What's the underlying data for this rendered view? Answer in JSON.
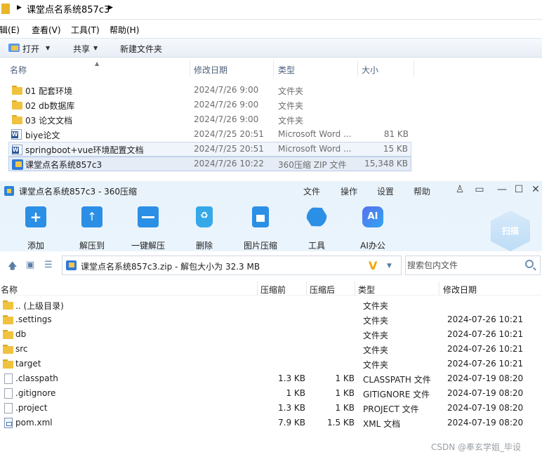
{
  "explorer": {
    "breadcrumb": "课堂点名系统857c3",
    "menu": [
      "辑(E)",
      "查看(V)",
      "工具(T)",
      "帮助(H)"
    ],
    "toolbar": {
      "open": "打开",
      "share": "共享",
      "new_folder": "新建文件夹"
    },
    "columns": [
      "名称",
      "修改日期",
      "类型",
      "大小"
    ],
    "files": [
      {
        "icon": "folder-icon",
        "name": "01 配套环境",
        "date": "2024/7/26 9:00",
        "type": "文件夹",
        "size": ""
      },
      {
        "icon": "folder-icon",
        "name": "02 db数据库",
        "date": "2024/7/26 9:00",
        "type": "文件夹",
        "size": ""
      },
      {
        "icon": "folder-icon",
        "name": "03 论文文档",
        "date": "2024/7/26 9:00",
        "type": "文件夹",
        "size": ""
      },
      {
        "icon": "word-doc-icon",
        "name": "biye论文",
        "date": "2024/7/25 20:51",
        "type": "Microsoft Word ...",
        "size": "81 KB"
      },
      {
        "icon": "word-doc-icon",
        "name": "springboot+vue环境配置文档",
        "date": "2024/7/25 20:51",
        "type": "Microsoft Word ...",
        "size": "15 KB"
      },
      {
        "icon": "zip-icon",
        "name": "课堂点名系统857c3",
        "date": "2024/7/26 10:22",
        "type": "360压缩 ZIP 文件",
        "size": "15,348 KB"
      }
    ]
  },
  "archive": {
    "title": "课堂点名系统857c3 - 360压缩",
    "menu": [
      "文件",
      "操作",
      "设置",
      "帮助"
    ],
    "ribbon": [
      "添加",
      "解压到",
      "一键解压",
      "删除",
      "图片压缩",
      "工具",
      "AI办公"
    ],
    "scan_label": "扫描",
    "path_text": "课堂点名系统857c3.zip - 解包大小为 32.3 MB",
    "search_placeholder": "搜索包内文件",
    "columns": [
      "名称",
      "压缩前",
      "压缩后",
      "类型",
      "修改日期"
    ],
    "files": [
      {
        "icon": "folder-icon",
        "name": ".. (上级目录)",
        "before": "",
        "after": "",
        "type": "文件夹",
        "date": ""
      },
      {
        "icon": "folder-icon",
        "name": ".settings",
        "before": "",
        "after": "",
        "type": "文件夹",
        "date": "2024-07-26 10:21"
      },
      {
        "icon": "folder-icon",
        "name": "db",
        "before": "",
        "after": "",
        "type": "文件夹",
        "date": "2024-07-26 10:21"
      },
      {
        "icon": "folder-icon",
        "name": "src",
        "before": "",
        "after": "",
        "type": "文件夹",
        "date": "2024-07-26 10:21"
      },
      {
        "icon": "folder-icon",
        "name": "target",
        "before": "",
        "after": "",
        "type": "文件夹",
        "date": "2024-07-26 10:21"
      },
      {
        "icon": "file-icon",
        "name": ".classpath",
        "before": "1.3 KB",
        "after": "1 KB",
        "type": "CLASSPATH 文件",
        "date": "2024-07-19 08:20"
      },
      {
        "icon": "file-icon",
        "name": ".gitignore",
        "before": "1 KB",
        "after": "1 KB",
        "type": "GITIGNORE 文件",
        "date": "2024-07-19 08:20"
      },
      {
        "icon": "file-icon",
        "name": ".project",
        "before": "1.3 KB",
        "after": "1 KB",
        "type": "PROJECT 文件",
        "date": "2024-07-19 08:20"
      },
      {
        "icon": "xml-file-icon",
        "name": "pom.xml",
        "before": "7.9 KB",
        "after": "1.5 KB",
        "type": "XML 文档",
        "date": "2024-07-19 08:20"
      }
    ]
  },
  "watermark": "CSDN @奉玄学姐_毕设"
}
